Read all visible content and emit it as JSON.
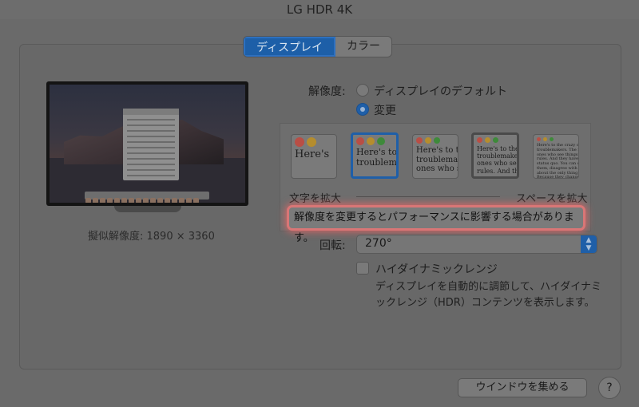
{
  "window": {
    "title": "LG HDR 4K"
  },
  "tabs": [
    {
      "label": "ディスプレイ",
      "active": true
    },
    {
      "label": "カラー",
      "active": false
    }
  ],
  "preview": {
    "resolution_label": "擬似解像度: 1890 × 3360"
  },
  "resolution": {
    "label": "解像度:",
    "options": [
      {
        "label": "ディスプレイのデフォルト",
        "selected": false
      },
      {
        "label": "変更",
        "selected": true
      }
    ]
  },
  "scaling": {
    "thumbnails": [
      {
        "text": "Here's",
        "state": "normal"
      },
      {
        "text": "Here's to\ntroublem",
        "state": "selected"
      },
      {
        "text": "Here's to t\ntroublema\nones who s",
        "state": "normal"
      },
      {
        "text": "Here's to the c\ntroublemakers\nones who see\nrules. And they",
        "state": "current"
      },
      {
        "text": "Here's to the crazy one\ntroublemakers. The rou\nones who see things d\nrules. And they have n\nstatus quo. You can qu\nthem, disagree with th\nabout the only thing y\nBecause they change t",
        "state": "normal"
      }
    ],
    "larger_text_label": "文字を拡大",
    "more_space_label": "スペースを拡大",
    "warning": "解像度を変更するとパフォーマンスに影響する場合があります。"
  },
  "rotation": {
    "label": "回転:",
    "value": "270°"
  },
  "hdr": {
    "label": "ハイダイナミックレンジ",
    "checked": false,
    "description": "ディスプレイを自動的に調節して、ハイダイナミックレンジ（HDR）コンテンツを表示します。"
  },
  "footer": {
    "gather_windows_label": "ウインドウを集める",
    "help_label": "?"
  },
  "colors": {
    "accent": "#1f5fa8",
    "warning_glow": "#e06666"
  }
}
